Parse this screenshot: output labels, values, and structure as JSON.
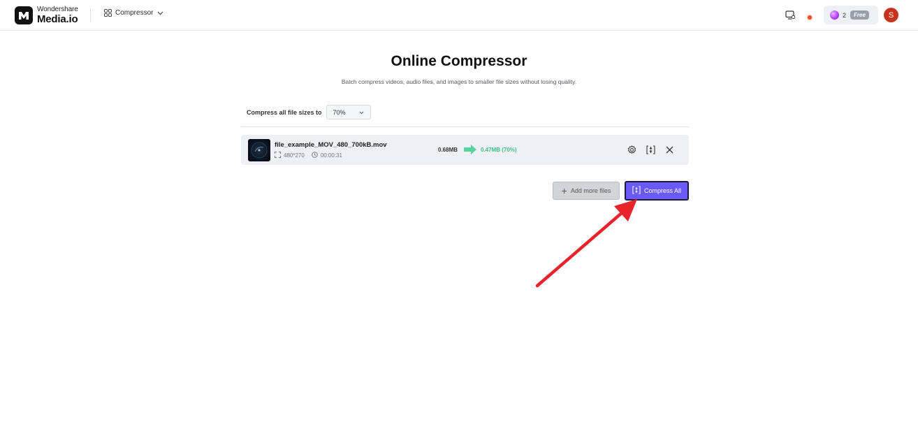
{
  "header": {
    "brand": "Wondershare",
    "product": "Media.io",
    "tool_menu_label": "Compressor",
    "credits_count": "2",
    "plan_badge": "Free",
    "avatar_initial": "S"
  },
  "main": {
    "title": "Online Compressor",
    "subtitle": "Batch compress videos, audio files, and images to smaller file sizes without losing quality.",
    "compress_label": "Compress all file sizes to",
    "compress_value": "70%"
  },
  "files": [
    {
      "name": "file_example_MOV_480_700kB.mov",
      "resolution": "480*270",
      "duration": "00:00:31",
      "original_size": "0.68MB",
      "compressed_size": "0.47MB (70%)"
    }
  ],
  "actions": {
    "add_more_label": "Add more files",
    "compress_all_label": "Compress All"
  },
  "colors": {
    "accent": "#6a5af9",
    "success": "#3cbf86",
    "avatar": "#c8331d",
    "annotation": "#e8232a"
  },
  "icons": {
    "tool_menu": "grid-icon",
    "screen": "screen-record-icon",
    "notification": "notification-dot-icon",
    "settings": "gear-icon",
    "compress": "compress-icon",
    "remove": "close-icon"
  }
}
